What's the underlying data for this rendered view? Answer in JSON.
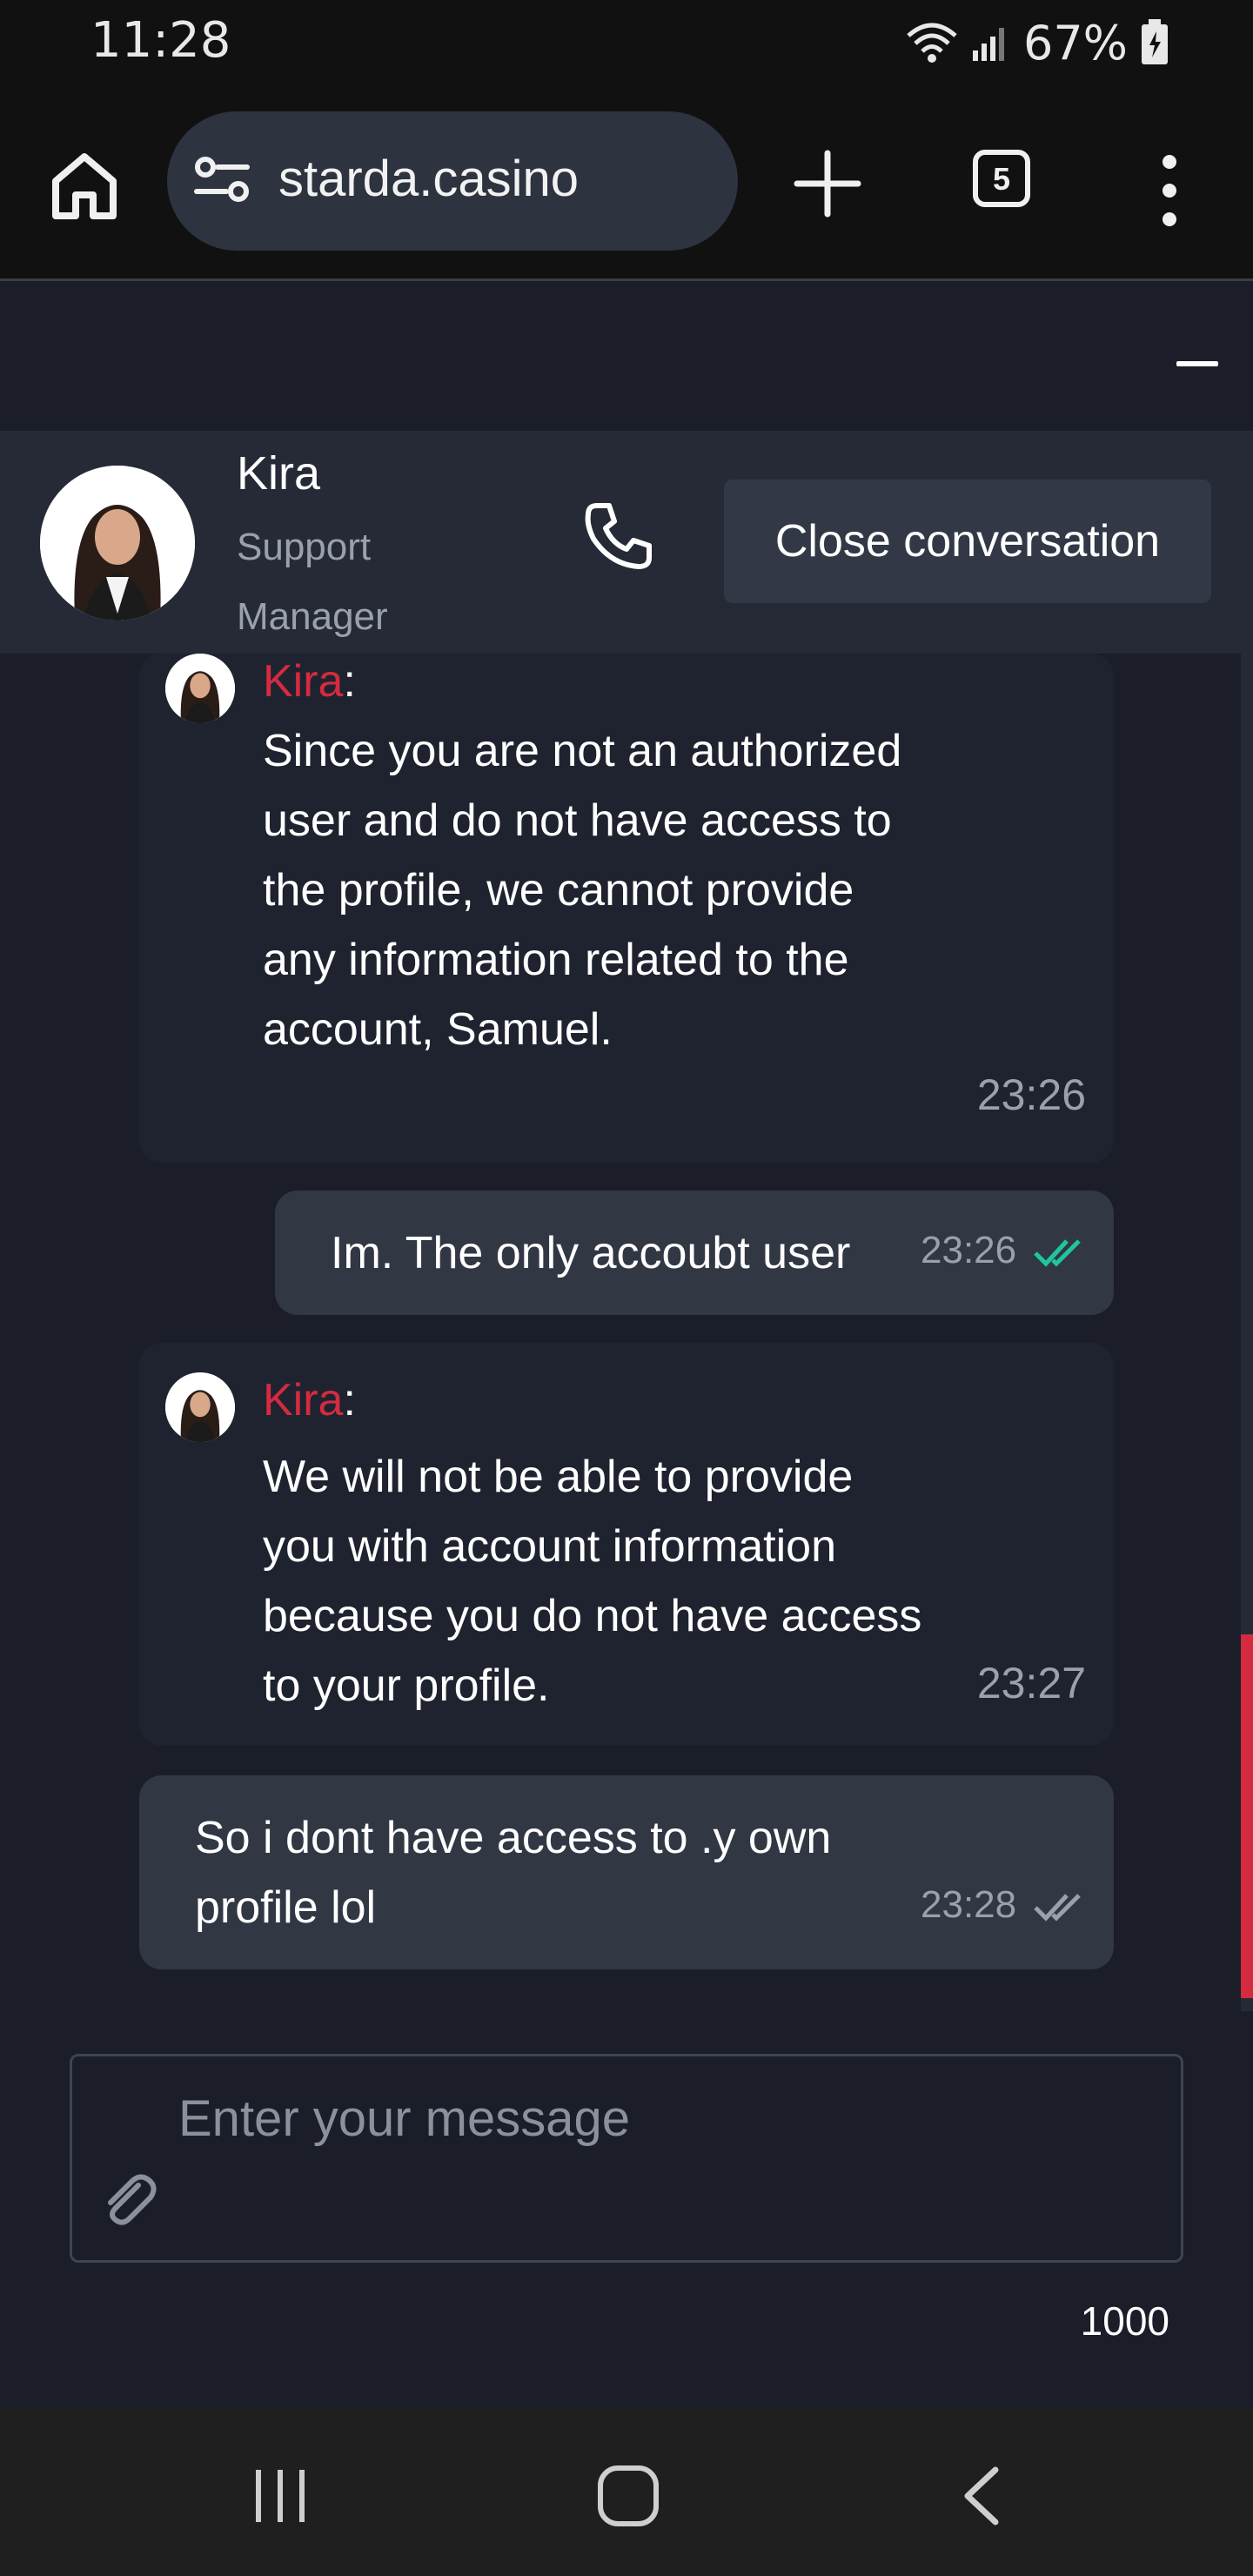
{
  "status_bar": {
    "time": "11:28",
    "battery": "67%"
  },
  "browser": {
    "url": "starda.casino",
    "tab_count": "5"
  },
  "chat_header": {
    "agent_name": "Kira",
    "agent_role": "Support Manager",
    "close_button": "Close conversation"
  },
  "messages": [
    {
      "from": "agent",
      "sender": "Kira",
      "text": "Since you are not an authorized user and do not have access to the profile, we cannot provide any information related to the account, Samuel.",
      "time": "23:26"
    },
    {
      "from": "user",
      "text": "Im. The only accoubt user",
      "time": "23:26",
      "status": "read"
    },
    {
      "from": "agent",
      "sender": "Kira",
      "text": "We will not be able to provide you with account information because you do not have access to your profile.",
      "time": "23:27"
    },
    {
      "from": "user",
      "text": "So i dont have access to .y own profile lol",
      "time": "23:28",
      "status": "delivered"
    }
  ],
  "composer": {
    "placeholder": "Enter your message",
    "char_limit": "1000"
  },
  "colors": {
    "accent": "#d42b3f",
    "read_tick": "#1ec6a0",
    "background": "#1b1e29"
  }
}
